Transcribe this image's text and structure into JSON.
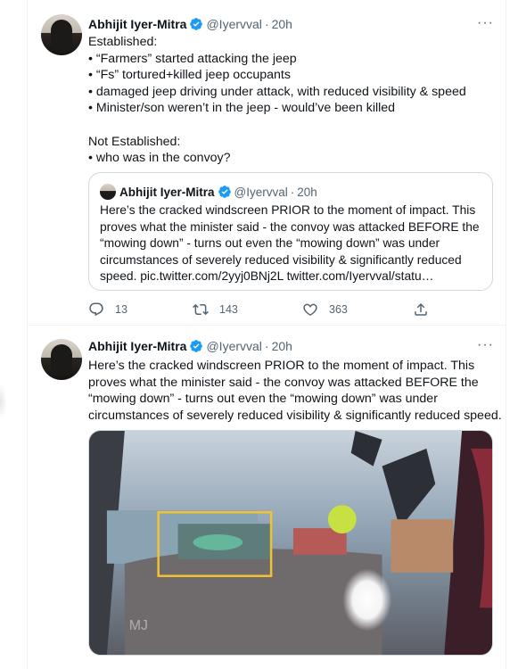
{
  "tweet1": {
    "author_name": "Abhijit Iyer-Mitra",
    "handle": "@Iyervval",
    "separator": "·",
    "time": "20h",
    "more": "···",
    "lines": [
      "Established:",
      "• “Farmers” started attacking the jeep",
      "• “Fs” tortured+killed jeep occupants",
      "• damaged jeep driving under attack, with reduced visibility & speed",
      "• Minister/son weren’t in the jeep - would’ve been killed",
      "",
      "Not Established:",
      "• who was in the convoy?"
    ],
    "quote": {
      "author_name": "Abhijit Iyer-Mitra",
      "handle": "@Iyervval",
      "separator": "·",
      "time": "20h",
      "lines": [
        "Here’s the cracked windscreen PRIOR to the moment of impact. This",
        "proves what the minister said - the convoy was attacked BEFORE the",
        "“mowing down” - turns out even the “mowing down” was under",
        "circumstances of severely reduced visibility & significantly reduced",
        "speed. pic.twitter.com/2yyj0BNj2L twitter.com/Iyervval/statu…"
      ]
    },
    "actions": {
      "replies": "13",
      "retweets": "143",
      "likes": "363"
    }
  },
  "tweet2": {
    "author_name": "Abhijit Iyer-Mitra",
    "handle": "@Iyervval",
    "separator": "·",
    "time": "20h",
    "more": "···",
    "lines": [
      "Here’s the cracked windscreen PRIOR to the moment of impact. This",
      "proves what the minister said - the convoy was attacked BEFORE the",
      "“mowing down” - turns out even the “mowing down” was under",
      "circumstances of severely reduced visibility & significantly reduced speed."
    ],
    "media_watermark": "MJ"
  },
  "colors": {
    "verified": "#1d9bf0",
    "secondary_text": "#536471",
    "border": "#cfd9de",
    "highlight_box": "#f2c230"
  }
}
